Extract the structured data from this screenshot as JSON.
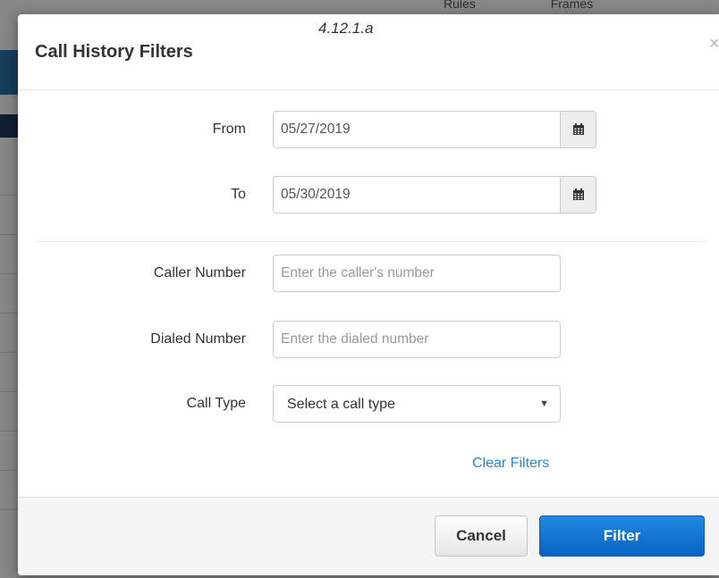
{
  "figure_label": "4.12.1.a",
  "background": {
    "tabs": [
      "Rules",
      "Frames"
    ]
  },
  "modal": {
    "title": "Call History Filters",
    "close_label": "×"
  },
  "form": {
    "from": {
      "label": "From",
      "value": "05/27/2019",
      "icon": "calendar-icon"
    },
    "to": {
      "label": "To",
      "value": "05/30/2019",
      "icon": "calendar-icon"
    },
    "caller_number": {
      "label": "Caller Number",
      "value": "",
      "placeholder": "Enter the caller's number"
    },
    "dialed_number": {
      "label": "Dialed Number",
      "value": "",
      "placeholder": "Enter the dialed number"
    },
    "call_type": {
      "label": "Call Type",
      "selected": "Select a call type",
      "caret": "▼"
    },
    "clear_filters": "Clear Filters"
  },
  "footer": {
    "cancel_label": "Cancel",
    "filter_label": "Filter"
  },
  "colors": {
    "primary_button": "#0b62c2",
    "link": "#2a8ac8",
    "overlay": "#000000"
  }
}
